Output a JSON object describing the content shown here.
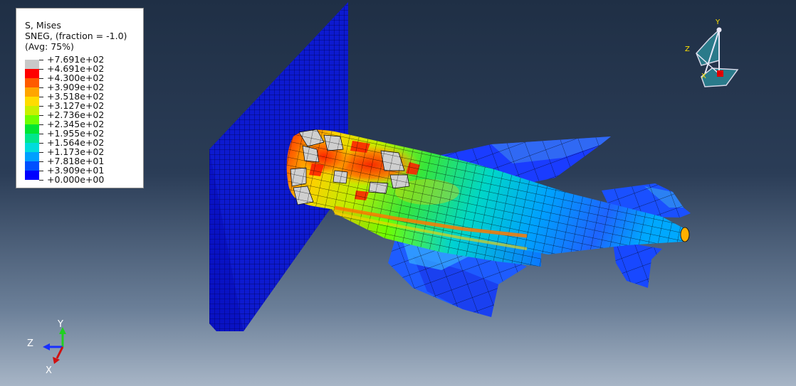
{
  "legend": {
    "line1": "S, Mises",
    "line2": "SNEG, (fraction = -1.0)",
    "line3": "(Avg: 75%)",
    "labels": [
      "+7.691e+02",
      "+4.691e+02",
      "+4.300e+02",
      "+3.909e+02",
      "+3.518e+02",
      "+3.127e+02",
      "+2.736e+02",
      "+2.345e+02",
      "+1.955e+02",
      "+1.564e+02",
      "+1.173e+02",
      "+7.818e+01",
      "+3.909e+01",
      "+0.000e+00"
    ],
    "colors": [
      "#c8c8c8",
      "#ff0000",
      "#ff5a00",
      "#ffa500",
      "#ffdc00",
      "#c8f000",
      "#6eff00",
      "#00e632",
      "#00e68c",
      "#00dcdc",
      "#00a0ff",
      "#0050ff",
      "#0000ff"
    ]
  },
  "triad": {
    "y": "Y",
    "z": "Z",
    "x": "X"
  },
  "view_cube": {
    "y": "Y",
    "z": "Z",
    "x": "X"
  },
  "colors": {
    "rigid_wall": "#0a14c8",
    "mesh_line": "#000000"
  }
}
